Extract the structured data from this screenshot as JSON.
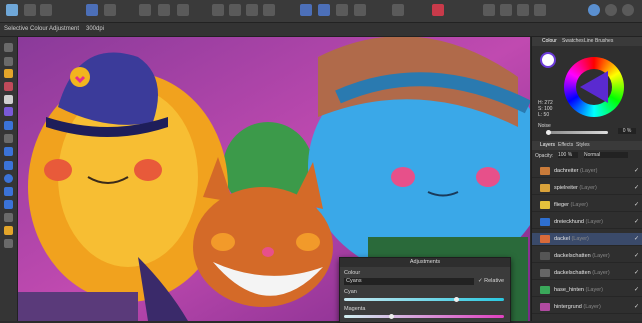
{
  "toolbar": {
    "icons": [
      "persona-icon",
      "move-icon",
      "share-icon",
      "assistant-icon",
      "snap-icon",
      "arrange-icon",
      "boolean-icon",
      "transform-icon",
      "align-icon",
      "colour-icon",
      "view-icon"
    ]
  },
  "context": {
    "tool": "Selective Colour Adjustment",
    "dpi": "300dpi"
  },
  "colour_panel": {
    "tabs": [
      "Colour",
      "Swatches",
      "Line",
      "Brushes"
    ],
    "hsl": [
      "H: 272",
      "S: 100",
      "L: 50"
    ],
    "noise_label": "Noise",
    "opacity_value": "0 %"
  },
  "layers_panel": {
    "tabs": [
      "Layers",
      "Effects",
      "Styles"
    ],
    "opacity_label": "Opacity:",
    "opacity_value": "100 %",
    "blend": "Normal",
    "layers": [
      {
        "name": "dachreiter",
        "type": "(Layer)",
        "color": "#c97b3a"
      },
      {
        "name": "spielreiter",
        "type": "(Layer)",
        "color": "#d9a23a"
      },
      {
        "name": "flieger",
        "type": "(Layer)",
        "color": "#e5c23c"
      },
      {
        "name": "dreieckhund",
        "type": "(Layer)",
        "color": "#2e6fd0"
      },
      {
        "name": "dackel",
        "type": "(Layer)",
        "color": "#d86a3a"
      },
      {
        "name": "dackelschatten",
        "type": "(Layer)",
        "color": "#555"
      },
      {
        "name": "dackelschatten",
        "type": "(Layer)",
        "color": "#666"
      },
      {
        "name": "hase_hinten",
        "type": "(Layer)",
        "color": "#3aa85a"
      },
      {
        "name": "hintergrund",
        "type": "(Layer)",
        "color": "#b04aa0"
      }
    ]
  },
  "adjustments": {
    "title": "Adjustments",
    "colour_label": "Colour",
    "colour_value": "Cyans",
    "relative_label": "Relative",
    "cyan_label": "Cyan",
    "magenta_label": "Magenta"
  }
}
